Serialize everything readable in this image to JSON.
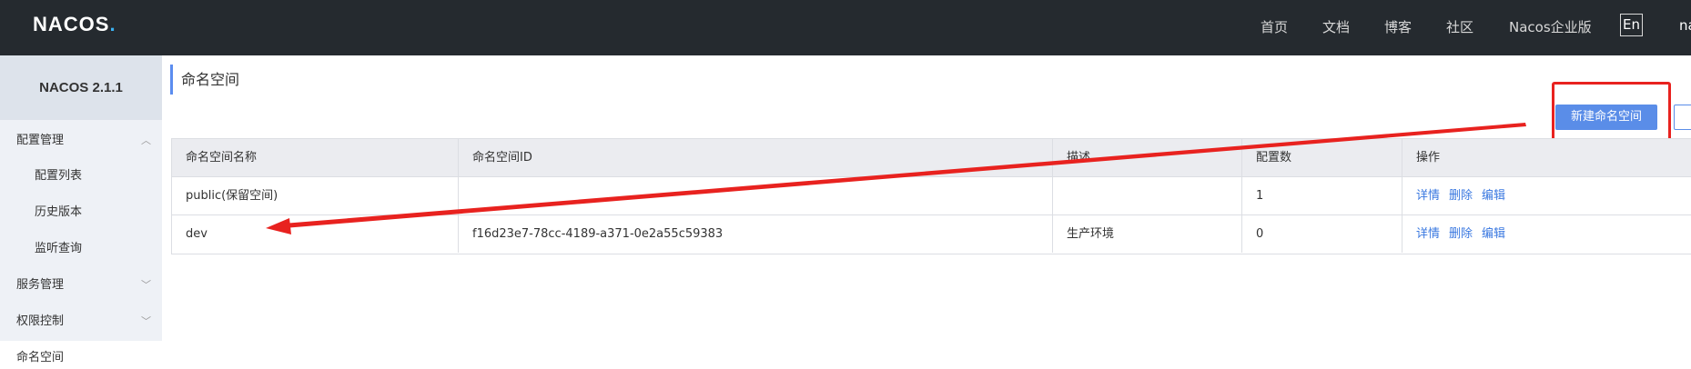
{
  "topbar": {
    "logo_text": "NACOS",
    "logo_dot": ".",
    "nav": [
      "首页",
      "文档",
      "博客",
      "社区",
      "Nacos企业版"
    ],
    "lang": "En",
    "user": "na"
  },
  "sidebar": {
    "version": "NACOS 2.1.1",
    "items": [
      {
        "label": "配置管理"
      },
      {
        "label": "配置列表"
      },
      {
        "label": "历史版本"
      },
      {
        "label": "监听查询"
      },
      {
        "label": "服务管理"
      },
      {
        "label": "权限控制"
      },
      {
        "label": "命名空间"
      }
    ]
  },
  "page": {
    "title": "命名空间",
    "new_namespace_button": "新建命名空间"
  },
  "table": {
    "headers": [
      "命名空间名称",
      "命名空间ID",
      "描述",
      "配置数",
      "操作"
    ],
    "rows": [
      {
        "name": "public(保留空间)",
        "id": "",
        "desc": "",
        "count": "1"
      },
      {
        "name": "dev",
        "id": "f16d23e7-78cc-4189-a371-0e2a55c59383",
        "desc": "生产环境",
        "count": "0"
      }
    ],
    "ops": {
      "detail": "详情",
      "delete": "删除",
      "edit": "编辑"
    }
  },
  "annotation_color": "#e8221f",
  "accent": "#5a8de8"
}
